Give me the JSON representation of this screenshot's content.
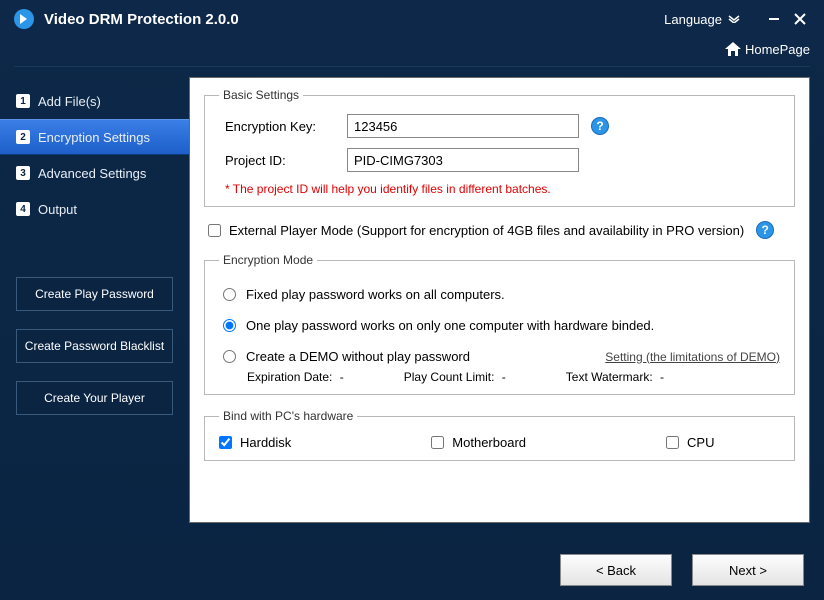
{
  "app": {
    "title": "Video DRM Protection 2.0.0",
    "language_label": "Language",
    "homepage_label": "HomePage"
  },
  "nav": {
    "items": [
      {
        "num": "1",
        "label": "Add File(s)"
      },
      {
        "num": "2",
        "label": "Encryption Settings"
      },
      {
        "num": "3",
        "label": "Advanced Settings"
      },
      {
        "num": "4",
        "label": "Output"
      }
    ],
    "active": 1
  },
  "side_buttons": {
    "create_play_password": "Create Play Password",
    "create_password_blacklist": "Create Password Blacklist",
    "create_your_player": "Create Your Player"
  },
  "basic": {
    "legend": "Basic Settings",
    "encryption_key_label": "Encryption Key:",
    "encryption_key_value": "123456",
    "project_id_label": "Project ID:",
    "project_id_value": "PID-CIMG7303",
    "hint": "* The project ID will help you identify files in different batches."
  },
  "external_player": {
    "label": "External Player Mode (Support for encryption of 4GB files and availability in PRO version)"
  },
  "encryption_mode": {
    "legend": "Encryption Mode",
    "option_fixed": "Fixed play password works on all computers.",
    "option_one": "One play password works on only one computer with hardware binded.",
    "option_demo": "Create a DEMO without play password",
    "setting_link": "Setting (the limitations of DEMO)",
    "expiration_label": "Expiration Date:",
    "expiration_value": "-",
    "play_count_label": "Play Count Limit:",
    "play_count_value": "-",
    "watermark_label": "Text Watermark:",
    "watermark_value": "-"
  },
  "bind": {
    "legend": "Bind with PC's hardware",
    "harddisk": "Harddisk",
    "motherboard": "Motherboard",
    "cpu": "CPU"
  },
  "footer": {
    "back": "<  Back",
    "next": "Next  >"
  }
}
